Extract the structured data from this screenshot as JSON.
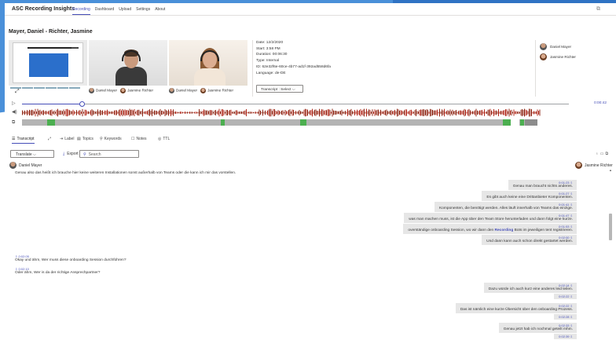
{
  "app": {
    "title": "ASC Recording Insights",
    "nav": [
      {
        "label": "Recording",
        "active": true
      },
      {
        "label": "Dashboard",
        "active": false
      },
      {
        "label": "Upload",
        "active": false
      },
      {
        "label": "Settings",
        "active": false
      },
      {
        "label": "About",
        "active": false
      }
    ]
  },
  "header": {
    "title": "Mayer, Daniel - Richter, Jasmine"
  },
  "thumbnails": {
    "person1_names": [
      "Daniel Mayer",
      "Jasmine Richter"
    ],
    "person2_names": [
      "Daniel Mayer",
      "Jasmine Richter"
    ]
  },
  "meta": {
    "date": "Date: 12/2/2020",
    "start": "Start: 3:58 PM",
    "duration": "Duration: 00:06:30",
    "type": "Type: Internal",
    "id": "ID: 62e32f6e-60ce-4b77-ad1f-392ad558d6fa",
    "language": "Language: de-DE",
    "transcript_select": "Transcript : Select"
  },
  "participants": [
    {
      "name": "Daniel Mayer",
      "gender": "m"
    },
    {
      "name": "Jasmine Richter",
      "gender": "f"
    }
  ],
  "player": {
    "end_time": "0:00:42",
    "progress": 0.11
  },
  "timeline_segments_colors": {
    "green": "#4caf50",
    "gray": "#b4b4b4",
    "white": "#ffffff",
    "dark": "#8c8c8c"
  },
  "tabs": [
    {
      "label": "Transcript",
      "icon": "transcript-icon",
      "active": true
    },
    {
      "label": "",
      "icon": "expand-icon",
      "active": false
    },
    {
      "label": "Label",
      "icon": "label-icon",
      "active": false
    },
    {
      "label": "Topics",
      "icon": "topics-icon",
      "active": false
    },
    {
      "label": "Keywords",
      "icon": "keywords-icon",
      "active": false
    },
    {
      "label": "Notes",
      "icon": "notes-icon",
      "active": false
    },
    {
      "label": "TTL",
      "icon": "ttl-icon",
      "active": false
    }
  ],
  "toolbar": {
    "translate_label": "Translate",
    "export_label": "Export",
    "search_placeholder": "Search"
  },
  "transcript": {
    "left_speaker": "Daniel Mayer",
    "right_speaker": "Jasmine Richter",
    "first_left_text": "Genau also das heißt ich brauche hier keine weiteren Installationen sonst außerhalb von Teams oder die kann ich mir das vorstellen.",
    "right_messages_1": [
      {
        "ts": "0:01:23",
        "text": "Genau man braucht nichts anderes."
      },
      {
        "ts": "0:01:27",
        "text": "Es gibt auch keine eine Drittanbieter Komponenten."
      },
      {
        "ts": "0:01:41",
        "text": "Komponenten, die benötigt werden. Alles läuft innerhalb von Teams das einzige."
      },
      {
        "ts": "0:01:47",
        "text": "was man machen muss, ist die App über den Team Store herunterladen und dann folgt eine kurze."
      },
      {
        "ts": "0:01:53",
        "text_before": "overständige onboarding Session, wo wir dann den ",
        "highlight": "Recording",
        "text_after": " Bots im jeweiligen tent registrieren."
      },
      {
        "ts": "0:02:00",
        "text": "Und dann kann auch schon direkt gestartet werden."
      }
    ],
    "left_messages": [
      {
        "ts": "0:02:05",
        "text": "Okay und ähm, Wer muss diese onboarding Session durchführen?"
      },
      {
        "ts": "0:02:10",
        "text": "Oder ähm, Wer is da der richtige Ansprechpartner?"
      }
    ],
    "right_messages_2": [
      {
        "ts": "0:02:14",
        "text": "Dazu würde ich auch kurz eine anderes leid teilen."
      },
      {
        "ts": "0:02:22",
        "text": ""
      },
      {
        "ts": "0:02:22",
        "text": "Das ist nämlich eine kurze Übersicht über den onboarding Prozess."
      },
      {
        "ts": "0:02:28",
        "text": ""
      },
      {
        "ts": "0:02:33",
        "text": "Genau jetzt hab ich nochmal geteilt mhm."
      },
      {
        "ts": "0:02:39",
        "text": ""
      }
    ]
  }
}
